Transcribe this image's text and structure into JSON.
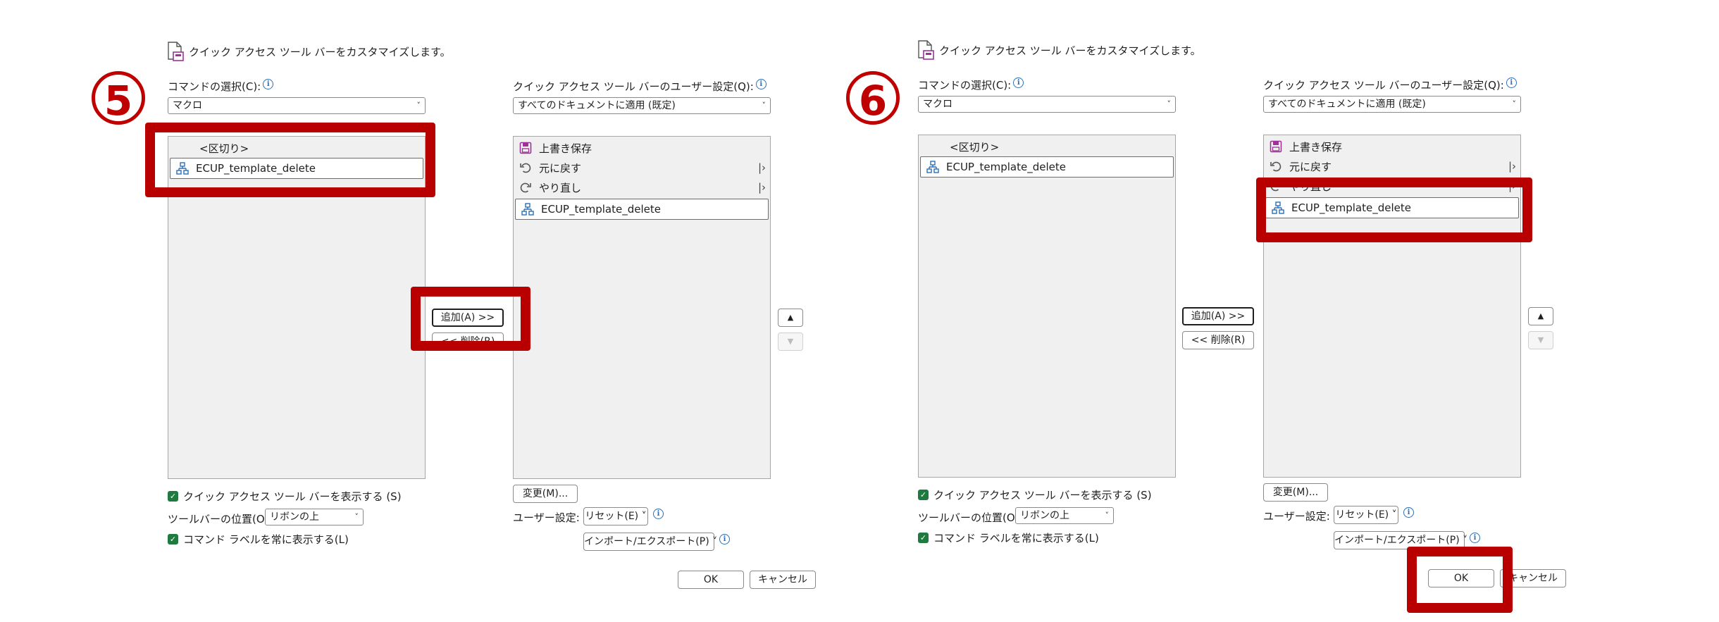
{
  "colors": {
    "accent_red": "#b80000",
    "check_green": "#1f7a3f",
    "info_blue": "#2a6fb8",
    "list_bg": "#f0f0f0"
  },
  "icons": {
    "doc": "customize-document-icon",
    "info": "info-icon",
    "macro": "macro-flowchart-icon",
    "save": "save-icon",
    "undo": "undo-icon",
    "redo": "redo-icon"
  },
  "panels": [
    {
      "step": "5",
      "title": "クイック アクセス ツール バーをカスタマイズします。",
      "choose_label": "コマンドの選択(C):",
      "choose_value": "マクロ",
      "qat_label": "クイック アクセス ツール バーのユーザー設定(Q):",
      "qat_value": "すべてのドキュメントに適用 (既定)",
      "left_items": [
        "<区切り>",
        "ECUP_template_delete"
      ],
      "right_items": [
        "上書き保存",
        "元に戻す",
        "やり直し",
        "ECUP_template_delete"
      ],
      "add_label": "追加(A) >>",
      "remove_label": "<< 削除(R)",
      "modify_label": "変更(M)...",
      "user_settings_label": "ユーザー設定:",
      "reset_label": "リセット(E) ˅",
      "import_export_label": "インポート/エクスポート(P) ˅",
      "show_qat_label": "クイック アクセス ツール バーを表示する (S)",
      "toolbar_pos_label": "ツールバーの位置(O)",
      "toolbar_pos_value": "リボンの上",
      "show_labels_label": "コマンド ラベルを常に表示する(L)",
      "ok_label": "OK",
      "cancel_label": "キャンセル"
    },
    {
      "step": "6",
      "title": "クイック アクセス ツール バーをカスタマイズします。",
      "choose_label": "コマンドの選択(C):",
      "choose_value": "マクロ",
      "qat_label": "クイック アクセス ツール バーのユーザー設定(Q):",
      "qat_value": "すべてのドキュメントに適用 (既定)",
      "left_items": [
        "<区切り>",
        "ECUP_template_delete"
      ],
      "right_items": [
        "上書き保存",
        "元に戻す",
        "やり直し",
        "ECUP_template_delete"
      ],
      "add_label": "追加(A) >>",
      "remove_label": "<< 削除(R)",
      "modify_label": "変更(M)...",
      "user_settings_label": "ユーザー設定:",
      "reset_label": "リセット(E) ˅",
      "import_export_label": "インポート/エクスポート(P) ˅",
      "show_qat_label": "クイック アクセス ツール バーを表示する (S)",
      "toolbar_pos_label": "ツールバーの位置(O)",
      "toolbar_pos_value": "リボンの上",
      "show_labels_label": "コマンド ラベルを常に表示する(L)",
      "ok_label": "OK",
      "cancel_label": "キャンセル"
    }
  ]
}
